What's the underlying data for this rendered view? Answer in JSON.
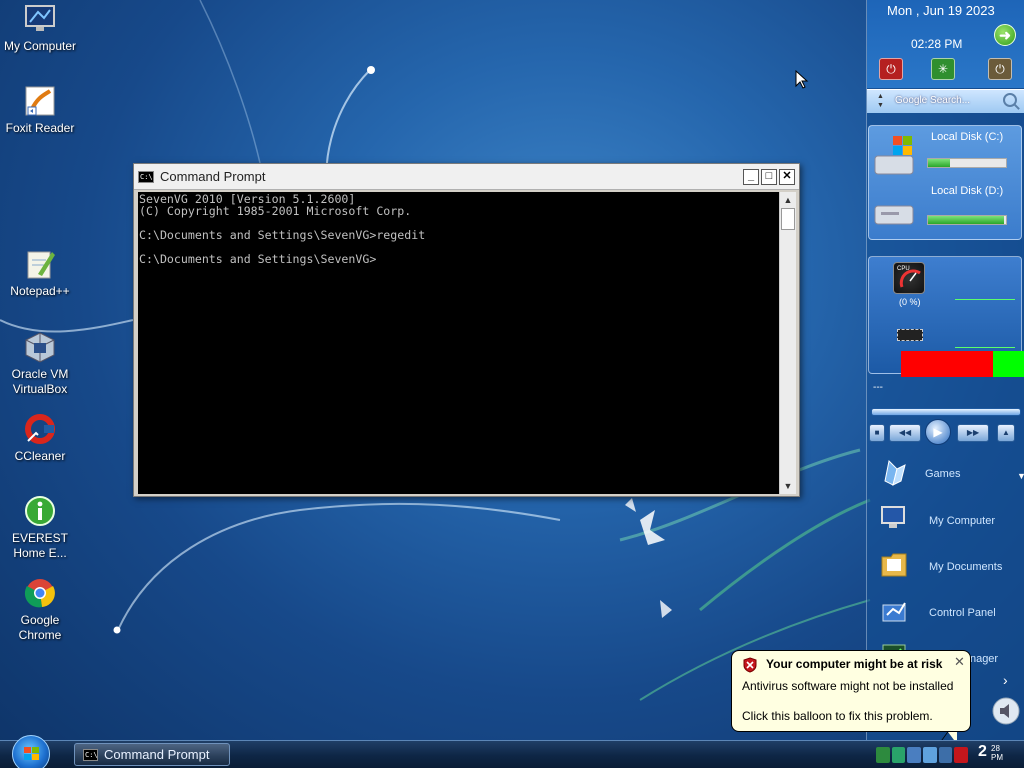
{
  "desktop": {
    "icons": [
      {
        "label": "My Computer"
      },
      {
        "label": "Foxit Reader"
      },
      {
        "label": "Notepad++"
      },
      {
        "label": "Oracle VM VirtualBox"
      },
      {
        "label": "CCleaner"
      },
      {
        "label": "EVEREST Home E..."
      },
      {
        "label": "Google Chrome"
      }
    ]
  },
  "cmd_window": {
    "title": "Command Prompt",
    "icon_text": "C:\\",
    "lines": [
      "SevenVG 2010 [Version 5.1.2600]",
      "(C) Copyright 1985-2001 Microsoft Corp.",
      "",
      "C:\\Documents and Settings\\SevenVG>regedit",
      "",
      "C:\\Documents and Settings\\SevenVG>"
    ],
    "controls": {
      "minimize": "_",
      "maximize": "□",
      "close": "✕"
    }
  },
  "sidebar": {
    "clock": {
      "date": "Mon , Jun 19 2023",
      "time": "02:28 PM"
    },
    "search": {
      "placeholder": "Google Search..."
    },
    "disks": [
      {
        "label": "Local Disk (C:)",
        "used_fraction": 0.28
      },
      {
        "label": "Local Disk (D:)",
        "used_fraction": 0.97
      }
    ],
    "cpu": {
      "percent_text": "(0 %)",
      "meter_label": "CPU"
    },
    "player": {
      "title": "---"
    },
    "launcher": [
      {
        "label": "Games"
      },
      {
        "label": "My Computer"
      },
      {
        "label": "My Documents"
      },
      {
        "label": "Control Panel"
      },
      {
        "label": "Task Manager"
      }
    ]
  },
  "balloon": {
    "title": "Your computer might be at risk",
    "line1": "Antivirus software might not be installed",
    "line2": "Click this balloon to fix this problem.",
    "close": "✕"
  },
  "taskbar": {
    "task_label": "Command Prompt",
    "clock_hour": "2",
    "clock_minutes": "28",
    "clock_ampm": "PM"
  },
  "colors": {
    "desktop_bg": "#1f5ca3",
    "console_bg": "#000000",
    "console_fg": "#c0c0c0",
    "balloon_bg": "#ffffe1",
    "cpu_red": "#ff0000",
    "cpu_green": "#00ff00"
  }
}
